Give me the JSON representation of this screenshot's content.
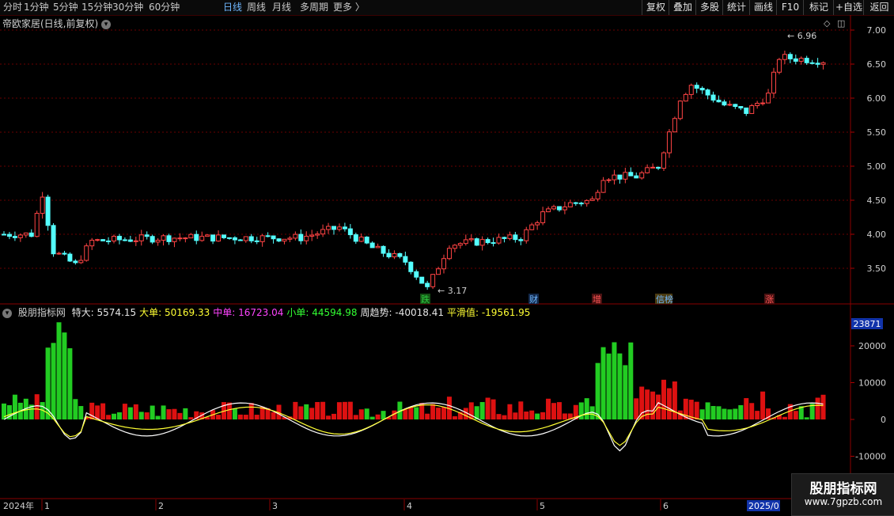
{
  "periods": [
    "分时",
    "1分钟",
    "5分钟",
    "15分钟",
    "30分钟",
    "60分钟",
    "日线",
    "周线",
    "月线",
    "多周期",
    "更多"
  ],
  "active_period": "日线",
  "toolbar": [
    "复权",
    "叠加",
    "多股",
    "统计",
    "画线",
    "F10",
    "标记",
    "+自选",
    "返回"
  ],
  "main_chart": {
    "title": "帝欧家居(日线,前复权)",
    "high_label": "6.96",
    "low_label": "3.17",
    "price_ticks": [
      "7.00",
      "6.50",
      "6.00",
      "5.50",
      "5.00",
      "4.50",
      "4.00",
      "3.50"
    ],
    "event_tags": [
      {
        "text": "跌",
        "color": "#2ecc40",
        "bg": "#145214"
      },
      {
        "text": "财",
        "color": "#6fb7ff",
        "bg": "#12284a"
      },
      {
        "text": "增",
        "color": "#ff5555",
        "bg": "#4a1212"
      },
      {
        "text": "信榜",
        "color": "#6fb7ff",
        "bg": "#4a3a10"
      },
      {
        "text": "涨",
        "color": "#ff5555",
        "bg": "#4a1212"
      }
    ]
  },
  "indicator": {
    "name": "股朋指标网",
    "fields": [
      {
        "label": "特大",
        "value": "5574.15",
        "color": "#e6e6e6"
      },
      {
        "label": "大单",
        "value": "50169.33",
        "color": "#ffff33"
      },
      {
        "label": "中单",
        "value": "16723.04",
        "color": "#ff44ff"
      },
      {
        "label": "小单",
        "value": "44594.98",
        "color": "#33ff33"
      },
      {
        "label": "周趋势",
        "value": "-40018.41",
        "color": "#e6e6e6"
      },
      {
        "label": "平滑值",
        "value": "-19561.95",
        "color": "#ffff33"
      }
    ],
    "current_value": "23871",
    "ticks": [
      "20000",
      "10000",
      "0",
      "-10000"
    ]
  },
  "time_axis": {
    "year_label": "2024年",
    "months": [
      "1",
      "2",
      "3",
      "4",
      "5",
      "6"
    ],
    "end_label": "2025/0"
  },
  "watermark": {
    "title": "股朋指标网",
    "url": "www.7gpzb.com"
  },
  "colors": {
    "up": "#ff4444",
    "down": "#54ffff",
    "vol_up": "#dd1111",
    "vol_down": "#22cc22",
    "grid": "#6a0000"
  }
}
